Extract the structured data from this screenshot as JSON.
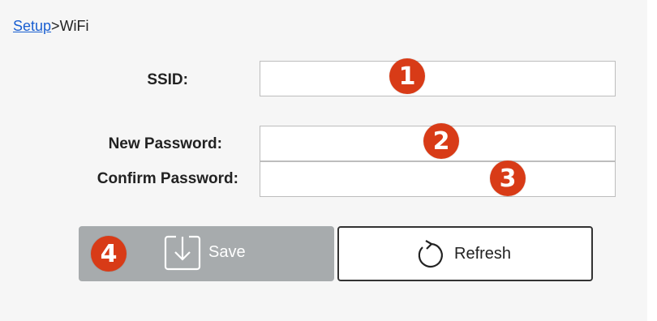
{
  "breadcrumb": {
    "link": "Setup",
    "separator": ">",
    "current": "WiFi"
  },
  "form": {
    "ssid_label": "SSID:",
    "ssid_value": "",
    "new_password_label": "New Password:",
    "new_password_value": "",
    "confirm_password_label": "Confirm Password:",
    "confirm_password_value": ""
  },
  "buttons": {
    "save_label": "Save",
    "save_icon": "save-download-icon",
    "refresh_label": "Refresh",
    "refresh_icon": "refresh-icon"
  },
  "badges": [
    "1",
    "2",
    "3",
    "4"
  ],
  "colors": {
    "badge": "#d83b17",
    "link": "#1a5fd1",
    "save_bg": "#a7abad",
    "panel_bg": "#f6f6f6"
  }
}
